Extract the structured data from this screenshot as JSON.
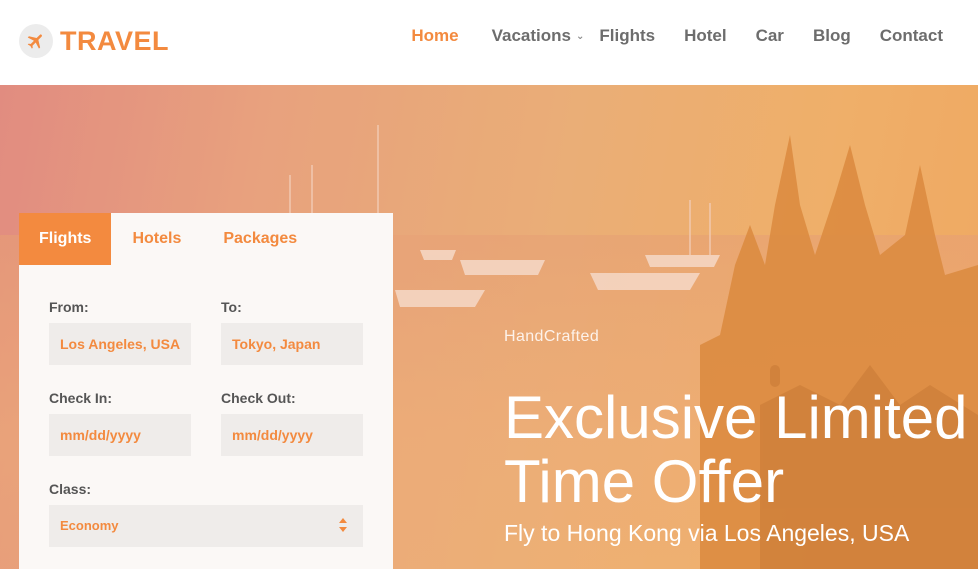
{
  "brand": {
    "name": "TRAVEL",
    "icon": "plane-icon",
    "accent": "#f38a3f"
  },
  "nav": {
    "items": [
      {
        "label": "Home",
        "active": true
      },
      {
        "label": "Vacations",
        "dropdown": true
      },
      {
        "label": "Flights"
      },
      {
        "label": "Hotel"
      },
      {
        "label": "Car"
      },
      {
        "label": "Blog"
      },
      {
        "label": "Contact"
      }
    ]
  },
  "booking": {
    "tabs": [
      {
        "label": "Flights",
        "active": true
      },
      {
        "label": "Hotels"
      },
      {
        "label": "Packages"
      }
    ],
    "from": {
      "label": "From:",
      "value": "Los Angeles, USA"
    },
    "to": {
      "label": "To:",
      "value": "Tokyo, Japan"
    },
    "check_in": {
      "label": "Check In:",
      "value": "mm/dd/yyyy"
    },
    "check_out": {
      "label": "Check Out:",
      "value": "mm/dd/yyyy"
    },
    "class": {
      "label": "Class:",
      "value": "Economy"
    }
  },
  "hero": {
    "kicker": "HandCrafted",
    "headline_line1": "Exclusive Limited",
    "headline_line2": "Time Offer",
    "subline": "Fly to Hong Kong via Los Angeles, USA"
  }
}
